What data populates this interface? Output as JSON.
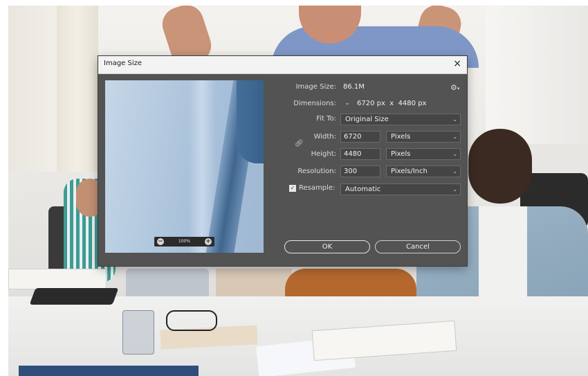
{
  "dialog": {
    "title": "Image Size",
    "close_glyph": "×",
    "preview": {
      "zoom_label": "100%",
      "zoom_out_glyph": "−",
      "zoom_in_glyph": "+"
    },
    "image_size": {
      "label": "Image Size:",
      "value": "86.1M"
    },
    "settings_icon": "gear-icon",
    "dimensions": {
      "label": "Dimensions:",
      "width": "6720",
      "unit1": "px",
      "times": "x",
      "height": "4480",
      "unit2": "px"
    },
    "fit_to": {
      "label": "Fit To:",
      "value": "Original Size"
    },
    "width": {
      "label": "Width:",
      "value": "6720",
      "unit": "Pixels"
    },
    "height": {
      "label": "Height:",
      "value": "4480",
      "unit": "Pixels"
    },
    "constrain_icon": "link-icon",
    "resolution": {
      "label": "Resolution:",
      "value": "300",
      "unit": "Pixels/Inch"
    },
    "resample": {
      "label": "Resample:",
      "checked": true,
      "value": "Automatic"
    },
    "ok_label": "OK",
    "cancel_label": "Cancel"
  }
}
